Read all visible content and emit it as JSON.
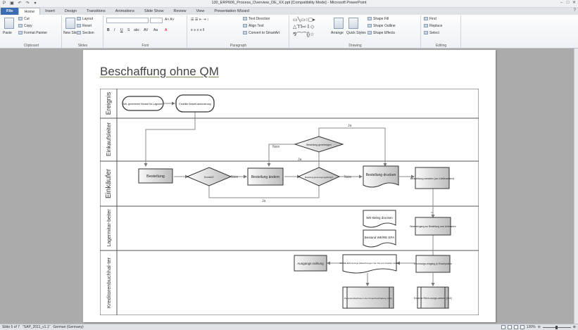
{
  "window": {
    "title": "130_ERP606_Process_Overview_DE_XX.ppt [Compatibility Mode] - Microsoft PowerPoint"
  },
  "tabs": [
    {
      "label": "File",
      "kind": "file"
    },
    {
      "label": "Home",
      "kind": "active"
    },
    {
      "label": "Insert",
      "kind": ""
    },
    {
      "label": "Design",
      "kind": ""
    },
    {
      "label": "Transitions",
      "kind": ""
    },
    {
      "label": "Animations",
      "kind": ""
    },
    {
      "label": "Slide Show",
      "kind": ""
    },
    {
      "label": "Review",
      "kind": ""
    },
    {
      "label": "View",
      "kind": ""
    },
    {
      "label": "Presentation Wizard",
      "kind": ""
    }
  ],
  "ribbon": {
    "clipboard": {
      "label": "Clipboard",
      "paste": "Paste",
      "cut": "Cut",
      "copy": "Copy",
      "format_painter": "Format Painter"
    },
    "slides": {
      "label": "Slides",
      "new_slide": "New Slide",
      "layout": "Layout",
      "reset": "Reset",
      "section": "Section"
    },
    "font": {
      "label": "Font"
    },
    "paragraph": {
      "label": "Paragraph",
      "text_direction": "Text Direction",
      "align_text": "Align Text",
      "smartart": "Convert to SmartArt"
    },
    "drawing": {
      "label": "Drawing",
      "arrange": "Arrange",
      "quick_styles": "Quick Styles",
      "shape_fill": "Shape Fill",
      "shape_outline": "Shape Outline",
      "shape_effects": "Shape Effects"
    },
    "editing": {
      "label": "Editing",
      "find": "Find",
      "replace": "Replace",
      "select": "Select"
    }
  },
  "slide": {
    "title": "Beschaffung ohne QM"
  },
  "lanes": [
    {
      "label": "Ereignis"
    },
    {
      "label": "Einkaufsleiter"
    },
    {
      "label": "Einkäufer"
    },
    {
      "label": "Lagermitar-beiter"
    },
    {
      "label": "Kreditorenbuchhal-ter"
    }
  ],
  "shapes": {
    "event1": "Mit.-generierter Bedarf für Lagerteil",
    "event2": "Erstellte Bestell-anforderung",
    "approve_q": "Bestellung genehmigen",
    "bestellung": "Bestellung",
    "korrekt": "Korrekt?",
    "aendern": "Bestellung ändern",
    "check_q": "Bestellung genehmigungspflichtig?",
    "drucken": "Bestellung drucken",
    "senden": "Bestellung senden (an Lieferanten)",
    "we_beleg": "WE-Beleg drucken",
    "bestand": "Bestand WE/RE EPA",
    "wareneingang": "Wareneingang zur Bestellung vom Lieferanten",
    "rechnung": "Rechnungs-eingang je Einzelposten",
    "epa": "WE/RE EPA Geringe Abweichungen Use Tax vom Kreditor zahlbar",
    "ausgang": "Ausgangs-zahlung",
    "perioden": "Periodenabschluss in der Finanzbuchhaltung (159)",
    "extern": "Externe Rech-nungs-wesen (162)"
  },
  "edge_labels": {
    "nein": "Nein",
    "ja": "Ja"
  },
  "status": {
    "slide": "Slide 5 of 7",
    "theme": "\"SAP_2011_v1.1\"",
    "language": "German (Germany)",
    "zoom": "120%"
  }
}
